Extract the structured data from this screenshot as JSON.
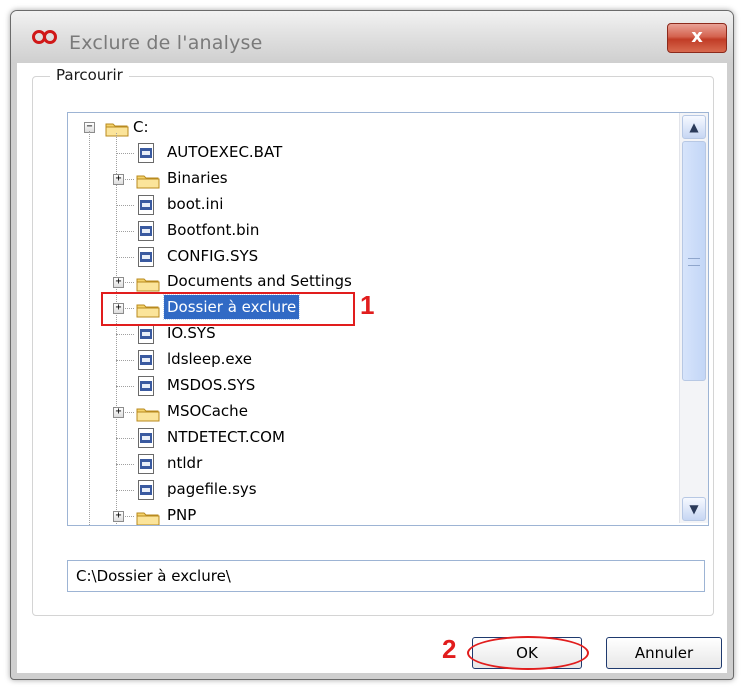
{
  "window": {
    "title": "Exclure de l'analyse",
    "close_label": "x"
  },
  "group": {
    "label": "Parcourir"
  },
  "tree": {
    "root": {
      "label": "C:",
      "expander": "−"
    },
    "items": [
      {
        "label": "AUTOEXEC.BAT",
        "kind": "file"
      },
      {
        "label": "Binaries",
        "kind": "folder",
        "expander": "+"
      },
      {
        "label": "boot.ini",
        "kind": "file"
      },
      {
        "label": "Bootfont.bin",
        "kind": "file"
      },
      {
        "label": "CONFIG.SYS",
        "kind": "file"
      },
      {
        "label": "Documents and Settings",
        "kind": "folder",
        "expander": "+"
      },
      {
        "label": "Dossier à exclure",
        "kind": "folder",
        "expander": "+",
        "selected": true
      },
      {
        "label": "IO.SYS",
        "kind": "file"
      },
      {
        "label": "ldsleep.exe",
        "kind": "file"
      },
      {
        "label": "MSDOS.SYS",
        "kind": "file"
      },
      {
        "label": "MSOCache",
        "kind": "folder",
        "expander": "+"
      },
      {
        "label": "NTDETECT.COM",
        "kind": "file"
      },
      {
        "label": "ntldr",
        "kind": "file"
      },
      {
        "label": "pagefile.sys",
        "kind": "file"
      },
      {
        "label": "PNP",
        "kind": "folder",
        "expander": "+"
      }
    ]
  },
  "path_field": {
    "value": "C:\\Dossier à exclure\\"
  },
  "buttons": {
    "ok": "OK",
    "cancel": "Annuler"
  },
  "annotations": {
    "step1": "1",
    "step2": "2"
  },
  "colors": {
    "selection": "#316ac5",
    "annotation": "#e11d1d"
  }
}
